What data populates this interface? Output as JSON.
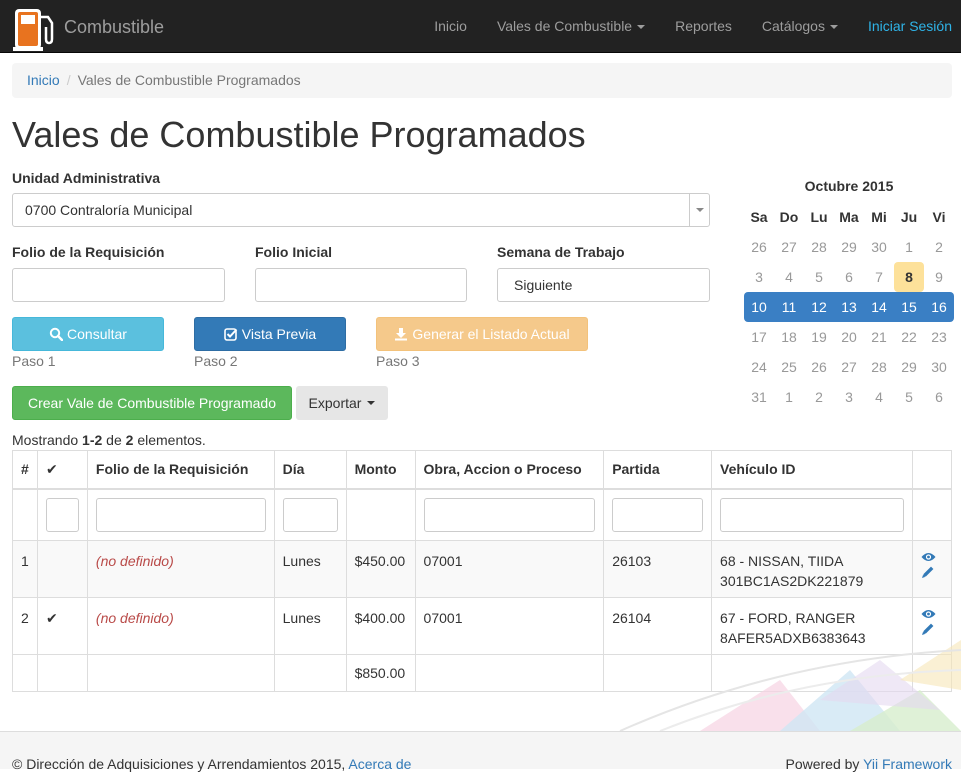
{
  "navbar": {
    "brand": "Combustible",
    "items": [
      {
        "label": "Inicio",
        "dropdown": false
      },
      {
        "label": "Vales de Combustible",
        "dropdown": true
      },
      {
        "label": "Reportes",
        "dropdown": false
      },
      {
        "label": "Catálogos",
        "dropdown": true
      }
    ],
    "login": "Iniciar Sesión"
  },
  "breadcrumb": {
    "home": "Inicio",
    "sep": "/",
    "current": "Vales de Combustible Programados"
  },
  "page_title": "Vales de Combustible Programados",
  "form": {
    "unidad_label": "Unidad Administrativa",
    "unidad_value": "0700 Contraloría Municipal",
    "folio_req_label": "Folio de la Requisición",
    "folio_req_value": "",
    "folio_ini_label": "Folio Inicial",
    "folio_ini_value": "",
    "semana_label": "Semana de Trabajo",
    "semana_value": "Siguiente"
  },
  "buttons": {
    "consultar": "Consultar",
    "vista_previa": "Vista Previa",
    "generar": "Generar el Listado Actual",
    "paso1": "Paso 1",
    "paso2": "Paso 2",
    "paso3": "Paso 3",
    "crear": "Crear Vale de Combustible Programado",
    "exportar": "Exportar"
  },
  "calendar": {
    "title": "Octubre 2015",
    "weekdays": [
      "Sa",
      "Do",
      "Lu",
      "Ma",
      "Mi",
      "Ju",
      "Vi"
    ],
    "weeks": [
      [
        "26",
        "27",
        "28",
        "29",
        "30",
        "1",
        "2"
      ],
      [
        "3",
        "4",
        "5",
        "6",
        "7",
        "8",
        "9"
      ],
      [
        "10",
        "11",
        "12",
        "13",
        "14",
        "15",
        "16"
      ],
      [
        "17",
        "18",
        "19",
        "20",
        "21",
        "22",
        "23"
      ],
      [
        "24",
        "25",
        "26",
        "27",
        "28",
        "29",
        "30"
      ],
      [
        "31",
        "1",
        "2",
        "3",
        "4",
        "5",
        "6"
      ]
    ],
    "today": "8",
    "selected_week": 2
  },
  "summary": {
    "prefix": "Mostrando ",
    "range": "1-2",
    "mid": " de ",
    "total": "2",
    "suffix": " elementos."
  },
  "table": {
    "headers": [
      "#",
      "✔",
      "Folio de la Requisición",
      "Día",
      "Monto",
      "Obra, Accion o Proceso",
      "Partida",
      "Vehículo ID",
      ""
    ],
    "rows": [
      {
        "num": "1",
        "check": "",
        "folio": "(no definido)",
        "dia": "Lunes",
        "monto": "$450.00",
        "obra": "07001",
        "partida": "26103",
        "vehiculo_1": "68 - NISSAN, TIIDA",
        "vehiculo_2": "301BC1AS2DK221879"
      },
      {
        "num": "2",
        "check": "✔",
        "folio": "(no definido)",
        "dia": "Lunes",
        "monto": "$400.00",
        "obra": "07001",
        "partida": "26104",
        "vehiculo_1": "67 - FORD, RANGER",
        "vehiculo_2": "8AFER5ADXB6383643"
      }
    ],
    "total_monto": "$850.00"
  },
  "footer": {
    "left": "© Dirección de Adquisiciones y Arrendamientos 2015, ",
    "left_link": "Acerca de",
    "right": "Powered by ",
    "right_link": "Yii Framework"
  },
  "colors": {
    "navbar": "#222222",
    "accent": "#337ab7",
    "success": "#5cb85c",
    "info": "#5bc0de",
    "warning": "#f0ad4e"
  }
}
